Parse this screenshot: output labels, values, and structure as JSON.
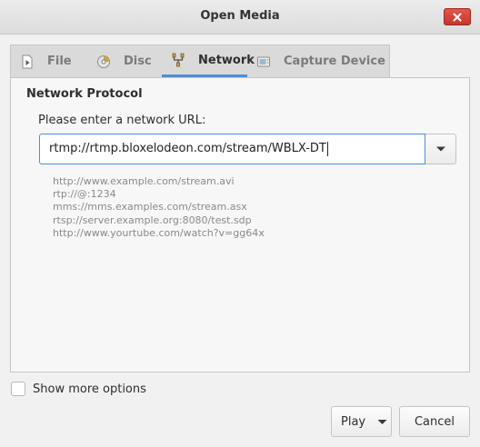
{
  "window": {
    "title": "Open Media"
  },
  "tabs": [
    {
      "label": "File",
      "icon": "file-icon",
      "active": false
    },
    {
      "label": "Disc",
      "icon": "disc-icon",
      "active": false
    },
    {
      "label": "Network",
      "icon": "network-icon",
      "active": true
    },
    {
      "label": "Capture Device",
      "icon": "capture-device-icon",
      "active": false
    }
  ],
  "network": {
    "section_title": "Network Protocol",
    "prompt": "Please enter a network URL:",
    "url_value": "rtmp://rtmp.bloxelodeon.com/stream/WBLX-DT",
    "examples": [
      "http://www.example.com/stream.avi",
      "rtp://@:1234",
      "mms://mms.examples.com/stream.asx",
      "rtsp://server.example.org:8080/test.sdp",
      "http://www.yourtube.com/watch?v=gg64x"
    ]
  },
  "options": {
    "show_more_label": "Show more options",
    "show_more_checked": false
  },
  "buttons": {
    "play": "Play",
    "cancel": "Cancel"
  },
  "colors": {
    "accent": "#4a90d9",
    "close": "#d9483b"
  }
}
